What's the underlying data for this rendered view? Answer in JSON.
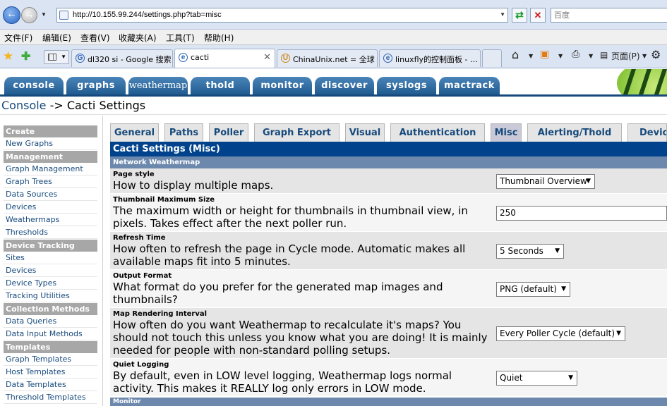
{
  "browser": {
    "url": "http://10.155.99.244/settings.php?tab=misc",
    "search_placeholder": "百度",
    "menu": [
      "文件(F)",
      "编辑(E)",
      "查看(V)",
      "收藏夹(A)",
      "工具(T)",
      "帮助(H)"
    ],
    "tabs": [
      {
        "title": "dl320 si - Google 搜索"
      },
      {
        "title": "cacti"
      },
      {
        "title": "ChinaUnix.net = 全球…"
      },
      {
        "title": "linuxfly的控制面板 - …"
      }
    ],
    "page_menu_label": "页面(P)"
  },
  "cacti": {
    "top_tabs": [
      "console",
      "graphs",
      "weathermap",
      "thold",
      "monitor",
      "discover",
      "syslogs",
      "mactrack"
    ],
    "breadcrumb_root": "Console",
    "breadcrumb_sep": " -> ",
    "breadcrumb_page": "Cacti Settings"
  },
  "sidebar": {
    "create": "Create",
    "new_graphs": "New Graphs",
    "management": "Management",
    "graph_management": "Graph Management",
    "graph_trees": "Graph Trees",
    "data_sources": "Data Sources",
    "devices": "Devices",
    "weathermaps": "Weathermaps",
    "thresholds": "Thresholds",
    "device_tracking": "Device Tracking",
    "sites": "Sites",
    "devices_2": "Devices",
    "device_types": "Device Types",
    "tracking_utilities": "Tracking Utilities",
    "collection_methods": "Collection Methods",
    "data_queries": "Data Queries",
    "data_input_methods": "Data Input Methods",
    "templates": "Templates",
    "graph_templates": "Graph Templates",
    "host_templates": "Host Templates",
    "data_templates": "Data Templates",
    "threshold_templates": "Threshold Templates"
  },
  "settings": {
    "tabs": [
      "General",
      "Paths",
      "Poller",
      "Graph Export",
      "Visual",
      "Authentication",
      "Misc",
      "Alerting/Thold",
      "Device"
    ],
    "active_tab": "Misc",
    "panel_title": "Cacti Settings (Misc)",
    "section": "Network Weathermap",
    "next_section": "Monitor",
    "rows": [
      {
        "label": "Page style",
        "desc": "How to display multiple maps.",
        "value": "Thumbnail Overview"
      },
      {
        "label": "Thumbnail Maximum Size",
        "desc": "The maximum width or height for thumbnails in thumbnail view, in pixels. Takes effect after the next poller run.",
        "value": "250"
      },
      {
        "label": "Refresh Time",
        "desc": "How often to refresh the page in Cycle mode. Automatic makes all available maps fit into 5 minutes.",
        "value": "5 Seconds"
      },
      {
        "label": "Output Format",
        "desc": "What format do you prefer for the generated map images and thumbnails?",
        "value": "PNG (default)"
      },
      {
        "label": "Map Rendering Interval",
        "desc": "How often do you want Weathermap to recalculate it's maps? You should not touch this unless you know what you are doing! It is mainly needed for people with non-standard polling setups.",
        "value": "Every Poller Cycle (default)"
      },
      {
        "label": "Quiet Logging",
        "desc": "By default, even in LOW level logging, Weathermap logs normal activity. This makes it REALLY log only errors in LOW mode.",
        "value": "Quiet"
      }
    ]
  }
}
